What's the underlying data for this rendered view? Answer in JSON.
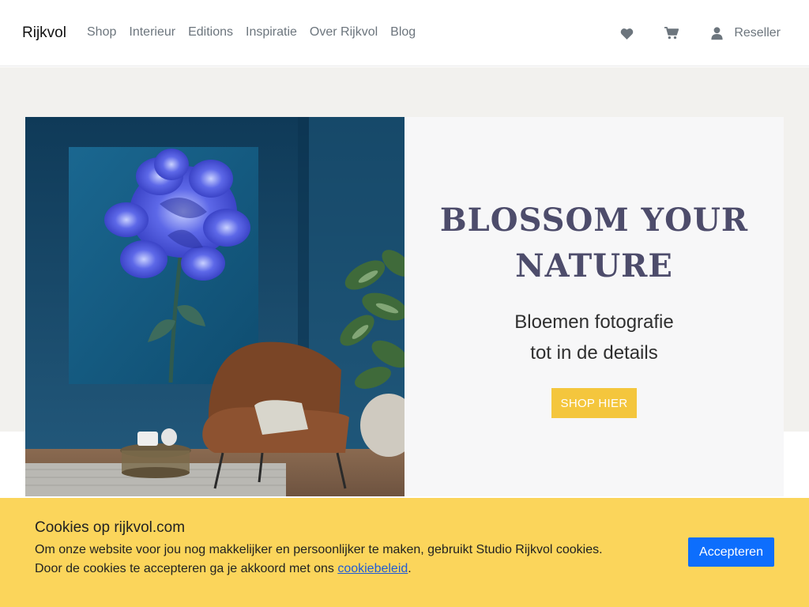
{
  "nav": {
    "brand": "Rijkvol",
    "links": [
      "Shop",
      "Interieur",
      "Editions",
      "Inspiratie",
      "Over Rijkvol",
      "Blog"
    ],
    "reseller": "Reseller",
    "icons": {
      "favorites": "heart-icon",
      "cart": "cart-icon",
      "account": "user-icon"
    }
  },
  "hero": {
    "title_line1": "BLOSSOM YOUR",
    "title_line2": "NATURE",
    "subtitle_line1": "Bloemen fotografie",
    "subtitle_line2": "tot in de details",
    "cta": "SHOP HIER"
  },
  "cookie": {
    "title": "Cookies op rijkvol.com",
    "line1": "Om onze website voor jou nog makkelijker en persoonlijker te maken, gebruikt Studio Rijkvol cookies.",
    "line2_prefix": "Door de cookies te accepteren ga je akkoord met ons ",
    "link": "cookiebeleid",
    "line2_suffix": ".",
    "accept": "Accepteren"
  },
  "colors": {
    "title": "#4d4c6b",
    "cta": "#f4c63d",
    "cookie_bg": "#fbd55b",
    "accept_btn": "#0d6efd"
  }
}
